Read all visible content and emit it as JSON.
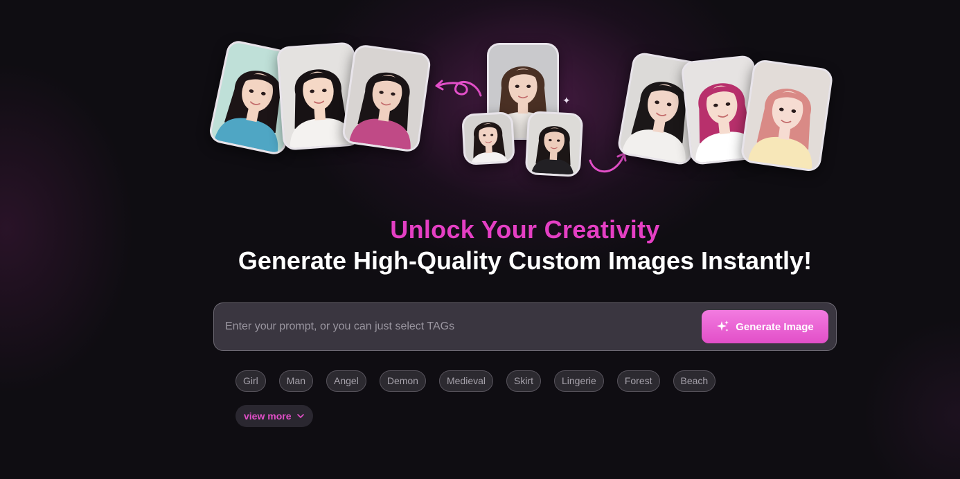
{
  "hero": {
    "portraits": [
      {
        "name": "portrait-girl-teal-shirt",
        "bg": "#bfe0d8",
        "hair": "#1c1416",
        "skin": "#f3d4c2",
        "shirt": "#4fa6c4"
      },
      {
        "name": "portrait-girl-white-shirt",
        "bg": "#e4e2e0",
        "hair": "#171214",
        "skin": "#f5d8c6",
        "shirt": "#f4f2f0"
      },
      {
        "name": "portrait-girl-pink-shirt",
        "bg": "#d8d4d2",
        "hair": "#1a1416",
        "skin": "#efd0c0",
        "shirt": "#c04a86"
      },
      {
        "name": "portrait-woman-center",
        "bg": "#c9c9cc",
        "hair": "#4a3024",
        "skin": "#f0d2c2",
        "shirt": "#eeeae6"
      },
      {
        "name": "portrait-woman-small",
        "bg": "#d4d2d0",
        "hair": "#1f1616",
        "skin": "#f1d3c4",
        "shirt": "#f4f2f2"
      },
      {
        "name": "portrait-man-small",
        "bg": "#dddbd8",
        "hair": "#1c1616",
        "skin": "#edcdbb",
        "shirt": "#222024"
      },
      {
        "name": "portrait-woman-black-hair",
        "bg": "#dcdad8",
        "hair": "#1b1718",
        "skin": "#f1d5c8",
        "shirt": "#f2f0ee"
      },
      {
        "name": "portrait-woman-magenta-hair",
        "bg": "#e6e3e2",
        "hair": "#b8306c",
        "skin": "#f6dccf",
        "shirt": "#ffffff"
      },
      {
        "name": "portrait-woman-pink-hair",
        "bg": "#e2dcd8",
        "hair": "#d98a86",
        "skin": "#f6dcd2",
        "shirt": "#f7e7b8"
      }
    ]
  },
  "headline": {
    "accent": "Unlock Your Creativity",
    "main": "Generate High-Quality Custom Images Instantly!"
  },
  "prompt": {
    "placeholder": "Enter your prompt, or you can just select TAGs",
    "value": "",
    "button_label": "Generate Image"
  },
  "tags": [
    "Girl",
    "Man",
    "Angel",
    "Demon",
    "Medieval",
    "Skirt",
    "Lingerie",
    "Forest",
    "Beach"
  ],
  "view_more": {
    "label": "view more",
    "icon": "chevron-down-icon"
  },
  "colors": {
    "accent": "#e53fc4",
    "button_gradient_top": "#f27be0",
    "button_gradient_bottom": "#e24fc8",
    "background": "#0f0d12"
  }
}
